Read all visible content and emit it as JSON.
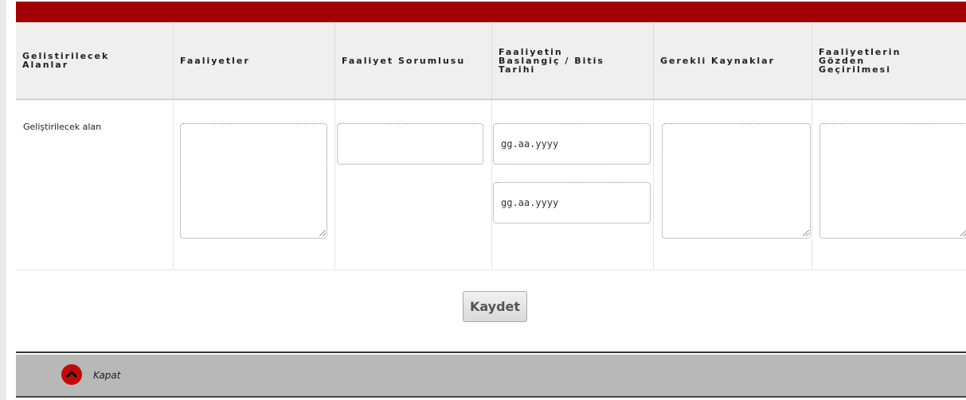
{
  "colors": {
    "top_bar": "#a30006",
    "header_bg": "#efefef",
    "footer_bg": "#b8b8b8",
    "close_icon": "#c30a0a"
  },
  "table": {
    "headers": [
      "Gelistirilecek\nAlanlar",
      "Faaliyetler",
      "Faaliyet Sorumlusu",
      "Faaliyetin\nBaslangiç / Bitis\nTarihi",
      "Gerekli Kaynaklar",
      "Faaliyetlerin\nGözden\nGeçirilmesi"
    ],
    "row_label": "Geliştirilecek alan",
    "start_date_placeholder": "gg.aa.yyyy",
    "end_date_placeholder": "gg.aa.yyyy"
  },
  "buttons": {
    "save_label": "Kaydet"
  },
  "footer": {
    "close_label": "Kapat",
    "close_icon": "chevron-up-icon"
  }
}
